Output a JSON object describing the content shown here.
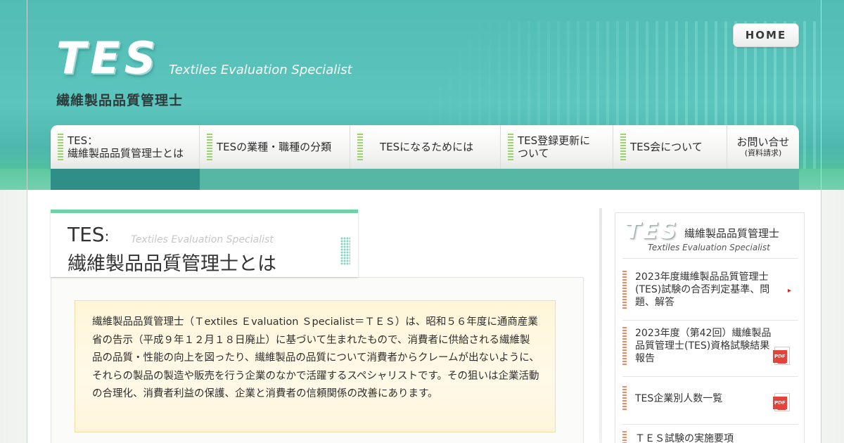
{
  "header": {
    "logo_text": "TES",
    "logo_subtitle": "Textiles Evaluation Specialist",
    "logo_jp": "繊維製品品質管理士",
    "home_label": "HOME"
  },
  "nav": {
    "items": [
      {
        "label": "TES：\n繊維製品品質管理士とは"
      },
      {
        "label": "TESの業種・職種の分類"
      },
      {
        "label": "TESになるためには"
      },
      {
        "label": "TES登録更新に\nついて"
      },
      {
        "label": "TES会について"
      },
      {
        "label": "お問い合せ",
        "sub": "(資料請求)"
      }
    ]
  },
  "main": {
    "title_prefix": "TES",
    "title_colon": ":",
    "title_en": "Textiles Evaluation Specialist",
    "title_jp": "繊維製品品質管理士とは",
    "body_text": "繊維製品品質管理士（Ｔextiles Ｅvaluation Ｓpecialist＝ＴＥＳ）は、昭和５６年度に通商産業省の告示（平成９年１２月１８日廃止）に基づいて生まれたもので、消費者に供給される繊維製品の品質・性能の向上を図ったり、繊維製品の品質について消費者からクレームが出ないように、それらの製品の製造や販売を行う企業のなかで活躍するスペシャリストです。その狙いは企業活動の合理化、消費者利益の保護、企業と消費者の信頼関係の改善にあります。"
  },
  "sidebar": {
    "logo_text": "TES",
    "title_jp": "繊維製品品質管理士",
    "title_en": "Textiles Evaluation Specialist",
    "items": [
      {
        "label": "2023年度繊維製品品質管理士(TES)試験の合否判定基準、問題、解答",
        "icon": "arrow-icon"
      },
      {
        "label": "2023年度（第42回）繊維製品品質管理士(TES)資格試験結果報告",
        "icon": "pdf-icon"
      },
      {
        "label": "TES企業別人数一覧",
        "icon": "pdf-icon"
      },
      {
        "label": "ＴＥＳ試験の実施要項",
        "icon": ""
      }
    ]
  }
}
